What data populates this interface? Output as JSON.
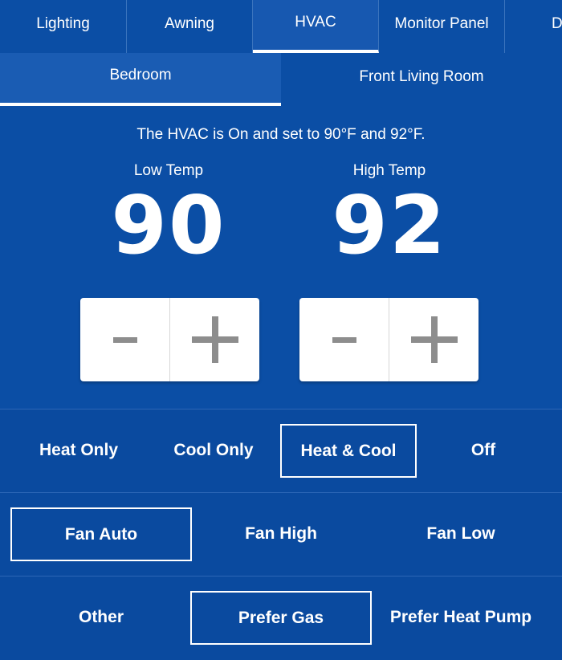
{
  "tabs": [
    "Lighting",
    "Awning",
    "HVAC",
    "Monitor Panel",
    "D"
  ],
  "active_tab": "HVAC",
  "rooms": [
    "Bedroom",
    "Front Living Room"
  ],
  "active_room": "Bedroom",
  "status_text": "The HVAC is On and set to 90°F and 92°F.",
  "low": {
    "label": "Low Temp",
    "value": "90"
  },
  "high": {
    "label": "High Temp",
    "value": "92"
  },
  "mode": {
    "options": [
      "Heat Only",
      "Cool Only",
      "Heat & Cool",
      "Off"
    ],
    "selected": "Heat & Cool"
  },
  "fan": {
    "options": [
      "Fan Auto",
      "Fan High",
      "Fan Low"
    ],
    "selected": "Fan Auto"
  },
  "source": {
    "options": [
      "Other",
      "Prefer Gas",
      "Prefer Heat Pump"
    ],
    "selected": "Prefer Gas"
  },
  "colors": {
    "background": "#0b4ea5",
    "text": "#ffffff",
    "stepper_bg": "#ffffff",
    "stepper_glyph": "#8d8d8d"
  },
  "icons": {
    "decrement": "minus-icon",
    "increment": "plus-icon"
  }
}
